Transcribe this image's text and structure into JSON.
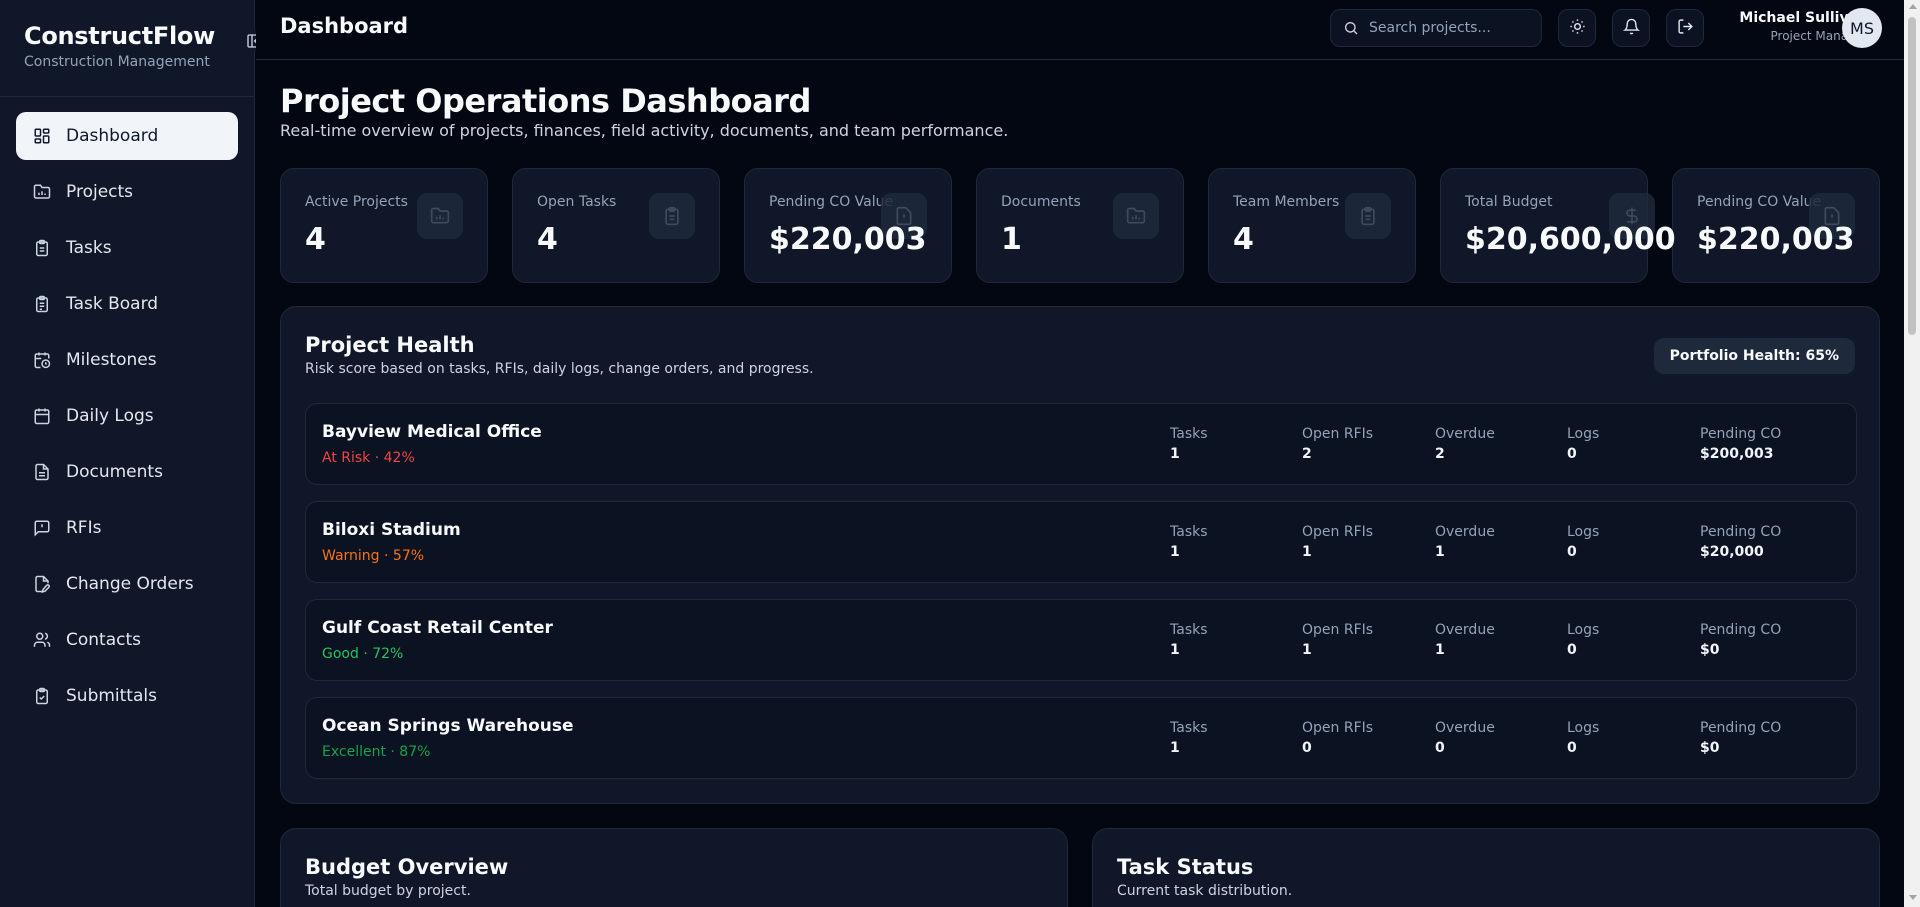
{
  "app": {
    "name": "ConstructFlow",
    "subtitle": "Construction Management"
  },
  "sidebar": {
    "items": [
      {
        "label": "Dashboard",
        "icon": "dashboard-icon",
        "active": true
      },
      {
        "label": "Projects",
        "icon": "folder-chart-icon"
      },
      {
        "label": "Tasks",
        "icon": "clipboard-icon"
      },
      {
        "label": "Task Board",
        "icon": "clipboard-list-icon"
      },
      {
        "label": "Milestones",
        "icon": "calendar-clock-icon"
      },
      {
        "label": "Daily Logs",
        "icon": "calendar-icon"
      },
      {
        "label": "Documents",
        "icon": "document-icon"
      },
      {
        "label": "RFIs",
        "icon": "message-alert-icon"
      },
      {
        "label": "Change Orders",
        "icon": "file-edit-icon"
      },
      {
        "label": "Contacts",
        "icon": "users-icon"
      },
      {
        "label": "Submittals",
        "icon": "clipboard-check-icon"
      }
    ]
  },
  "header": {
    "title": "Dashboard",
    "search_placeholder": "Search projects...",
    "user": {
      "name": "Michael Sullivan",
      "role": "Project Manager",
      "initials": "MS"
    }
  },
  "page": {
    "title": "Project Operations Dashboard",
    "subtitle": "Real-time overview of projects, finances, field activity, documents, and team performance."
  },
  "stats": [
    {
      "label": "Active Projects",
      "value": "4",
      "icon": "folder-chart-icon"
    },
    {
      "label": "Open Tasks",
      "value": "4",
      "icon": "clipboard-icon"
    },
    {
      "label": "Pending CO Value",
      "value": "$220,003",
      "icon": "file-alert-icon"
    },
    {
      "label": "Documents",
      "value": "1",
      "icon": "folder-chart-icon"
    },
    {
      "label": "Team Members",
      "value": "4",
      "icon": "clipboard-icon"
    },
    {
      "label": "Total Budget",
      "value": "$20,600,000",
      "icon": "dollar-icon"
    },
    {
      "label": "Pending CO Value",
      "value": "$220,003",
      "icon": "file-alert-icon"
    }
  ],
  "health": {
    "title": "Project Health",
    "subtitle": "Risk score based on tasks, RFIs, daily logs, change orders, and progress.",
    "portfolio_badge": "Portfolio Health: 65%",
    "metric_labels": {
      "tasks": "Tasks",
      "rfis": "Open RFIs",
      "overdue": "Overdue",
      "logs": "Logs",
      "co": "Pending CO"
    },
    "projects": [
      {
        "name": "Bayview Medical Office",
        "status": "At Risk · 42%",
        "color": "#ef4444",
        "tasks": "1",
        "rfis": "2",
        "overdue": "2",
        "logs": "0",
        "co": "$200,003"
      },
      {
        "name": "Biloxi Stadium",
        "status": "Warning · 57%",
        "color": "#f97316",
        "tasks": "1",
        "rfis": "1",
        "overdue": "1",
        "logs": "0",
        "co": "$20,000"
      },
      {
        "name": "Gulf Coast Retail Center",
        "status": "Good · 72%",
        "color": "#22c55e",
        "tasks": "1",
        "rfis": "1",
        "overdue": "1",
        "logs": "0",
        "co": "$0"
      },
      {
        "name": "Ocean Springs Warehouse",
        "status": "Excellent · 87%",
        "color": "#16a34a",
        "tasks": "1",
        "rfis": "0",
        "overdue": "0",
        "logs": "0",
        "co": "$0"
      }
    ]
  },
  "budget": {
    "title": "Budget Overview",
    "subtitle": "Total budget by project."
  },
  "task_status": {
    "title": "Task Status",
    "subtitle": "Current task distribution."
  }
}
